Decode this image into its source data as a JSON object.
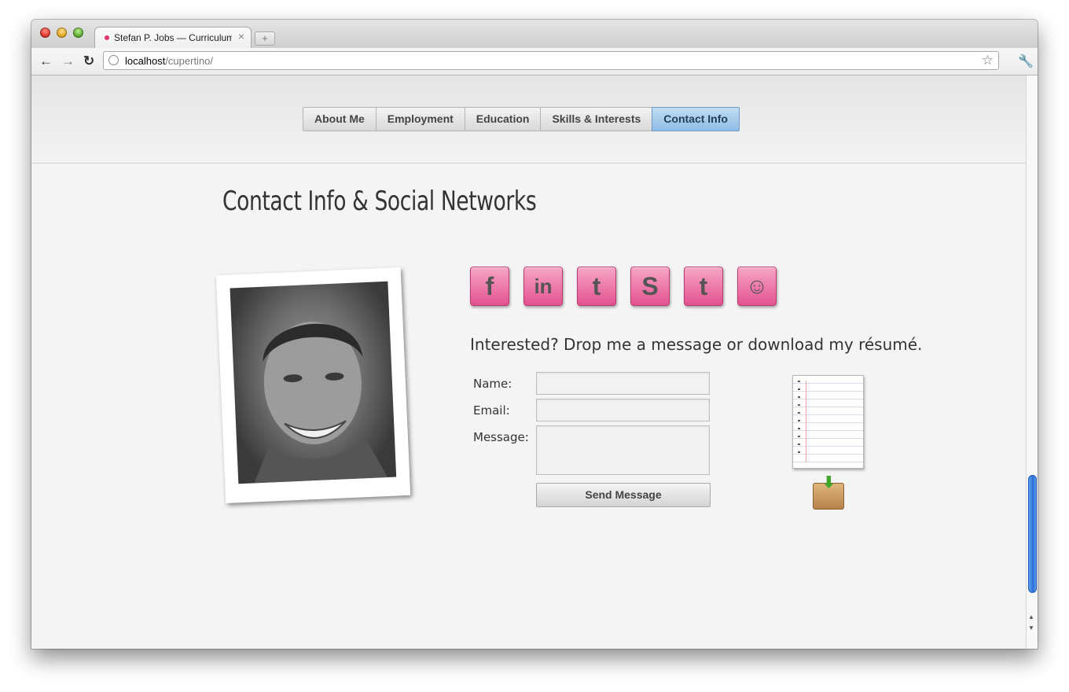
{
  "browser": {
    "tab_title": "Stefan P. Jobs — Curriculum",
    "tab_close": "×",
    "new_tab": "+",
    "back": "←",
    "forward": "→",
    "reload": "↻",
    "url_host": "localhost",
    "url_path": "/cupertino/",
    "bookmark": "☆",
    "wrench": "🔧"
  },
  "nav": {
    "items": [
      "About Me",
      "Employment",
      "Education",
      "Skills & Interests",
      "Contact Info"
    ],
    "active": "Contact Info"
  },
  "page": {
    "title": "Contact Info & Social Networks",
    "cta": "Interested? Drop me a message or download my résumé."
  },
  "social": [
    {
      "icon": "facebook-icon",
      "glyph": "f"
    },
    {
      "icon": "linkedin-icon",
      "glyph": "in"
    },
    {
      "icon": "twitter-icon",
      "glyph": "t"
    },
    {
      "icon": "skype-icon",
      "glyph": "S"
    },
    {
      "icon": "tumblr-icon",
      "glyph": "t"
    },
    {
      "icon": "reddit-icon",
      "glyph": "☺"
    }
  ],
  "form": {
    "name_label": "Name:",
    "email_label": "Email:",
    "message_label": "Message:",
    "name_value": "",
    "email_value": "",
    "message_value": "",
    "send_label": "Send Message"
  },
  "colors": {
    "nav_active": "#8fbde4",
    "social_pink": "#e3528f"
  }
}
